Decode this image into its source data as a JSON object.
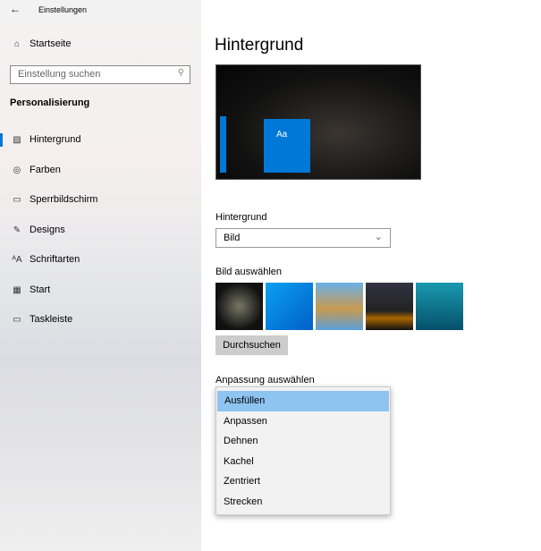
{
  "window": {
    "title": "Einstellungen"
  },
  "sidebar": {
    "home": "Startseite",
    "search_placeholder": "Einstellung suchen",
    "section": "Personalisierung",
    "items": [
      {
        "label": "Hintergrund",
        "icon": "image-icon"
      },
      {
        "label": "Farben",
        "icon": "palette-icon"
      },
      {
        "label": "Sperrbildschirm",
        "icon": "lock-screen-icon"
      },
      {
        "label": "Designs",
        "icon": "designs-icon"
      },
      {
        "label": "Schriftarten",
        "icon": "fonts-icon"
      },
      {
        "label": "Start",
        "icon": "start-icon"
      },
      {
        "label": "Taskleiste",
        "icon": "taskbar-icon"
      }
    ]
  },
  "main": {
    "title": "Hintergrund",
    "preview_tile": "Aa",
    "background_label": "Hintergrund",
    "background_value": "Bild",
    "choose_image_label": "Bild auswählen",
    "browse": "Durchsuchen",
    "fit_label": "Anpassung auswählen",
    "fit_options": [
      "Ausfüllen",
      "Anpassen",
      "Dehnen",
      "Kachel",
      "Zentriert",
      "Strecken"
    ],
    "fit_selected": "Ausfüllen"
  },
  "colors": {
    "accent": "#0078d7",
    "highlight": "#8ec4f0"
  }
}
